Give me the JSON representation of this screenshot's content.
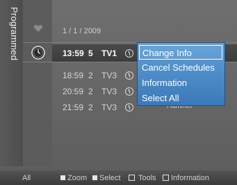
{
  "sidebar": {
    "title": "Programmed"
  },
  "header": {
    "date": "1 / 1 / 2009"
  },
  "rows": [
    {
      "time": "13:59",
      "num": "5",
      "channel": "TV1"
    },
    {
      "time": "18:59",
      "num": "2",
      "channel": "TV3"
    },
    {
      "time": "20:59",
      "num": "2",
      "channel": "TV3"
    },
    {
      "time": "21:59",
      "num": "2",
      "channel": "TV3"
    }
  ],
  "menu": {
    "items": [
      "Change Info",
      "Cancel Schedules",
      "Information",
      "Select All"
    ],
    "selected": "Change Info"
  },
  "overflow_text": "M.Spillane's Mike Hammer",
  "bottom": {
    "all_label": "All",
    "zoom_label": "Zoom",
    "select_label": "Select",
    "tools_label": "Tools",
    "information_label": "Information"
  },
  "icons": [
    "heart-icon",
    "clock-icon",
    "tools-icon",
    "information-icon"
  ]
}
